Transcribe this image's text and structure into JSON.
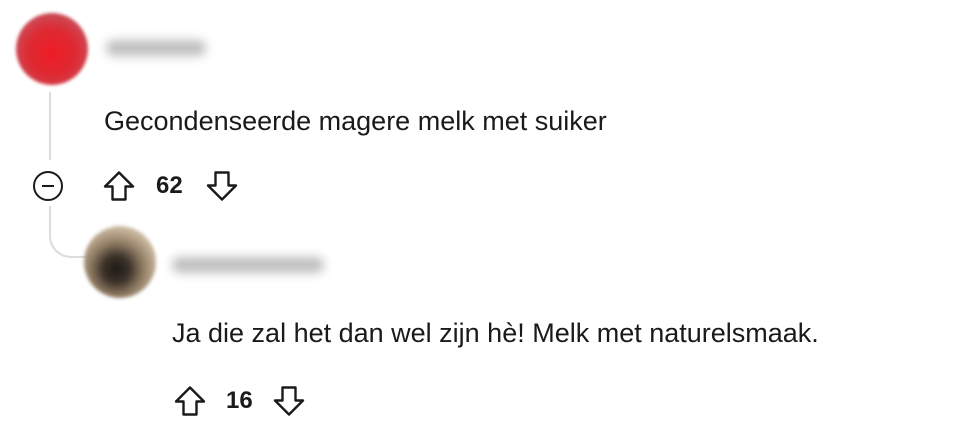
{
  "comments": [
    {
      "username": "",
      "text": "Gecondenseerde magere melk met suiker",
      "score": "62"
    },
    {
      "username": "",
      "text": "Ja die zal het dan wel zijn hè! Melk met naturelsmaak.",
      "score": "16"
    }
  ],
  "icons": {
    "upvote": "arrow-up-outline-icon",
    "downvote": "arrow-down-outline-icon",
    "collapse": "minus-circle-icon"
  }
}
